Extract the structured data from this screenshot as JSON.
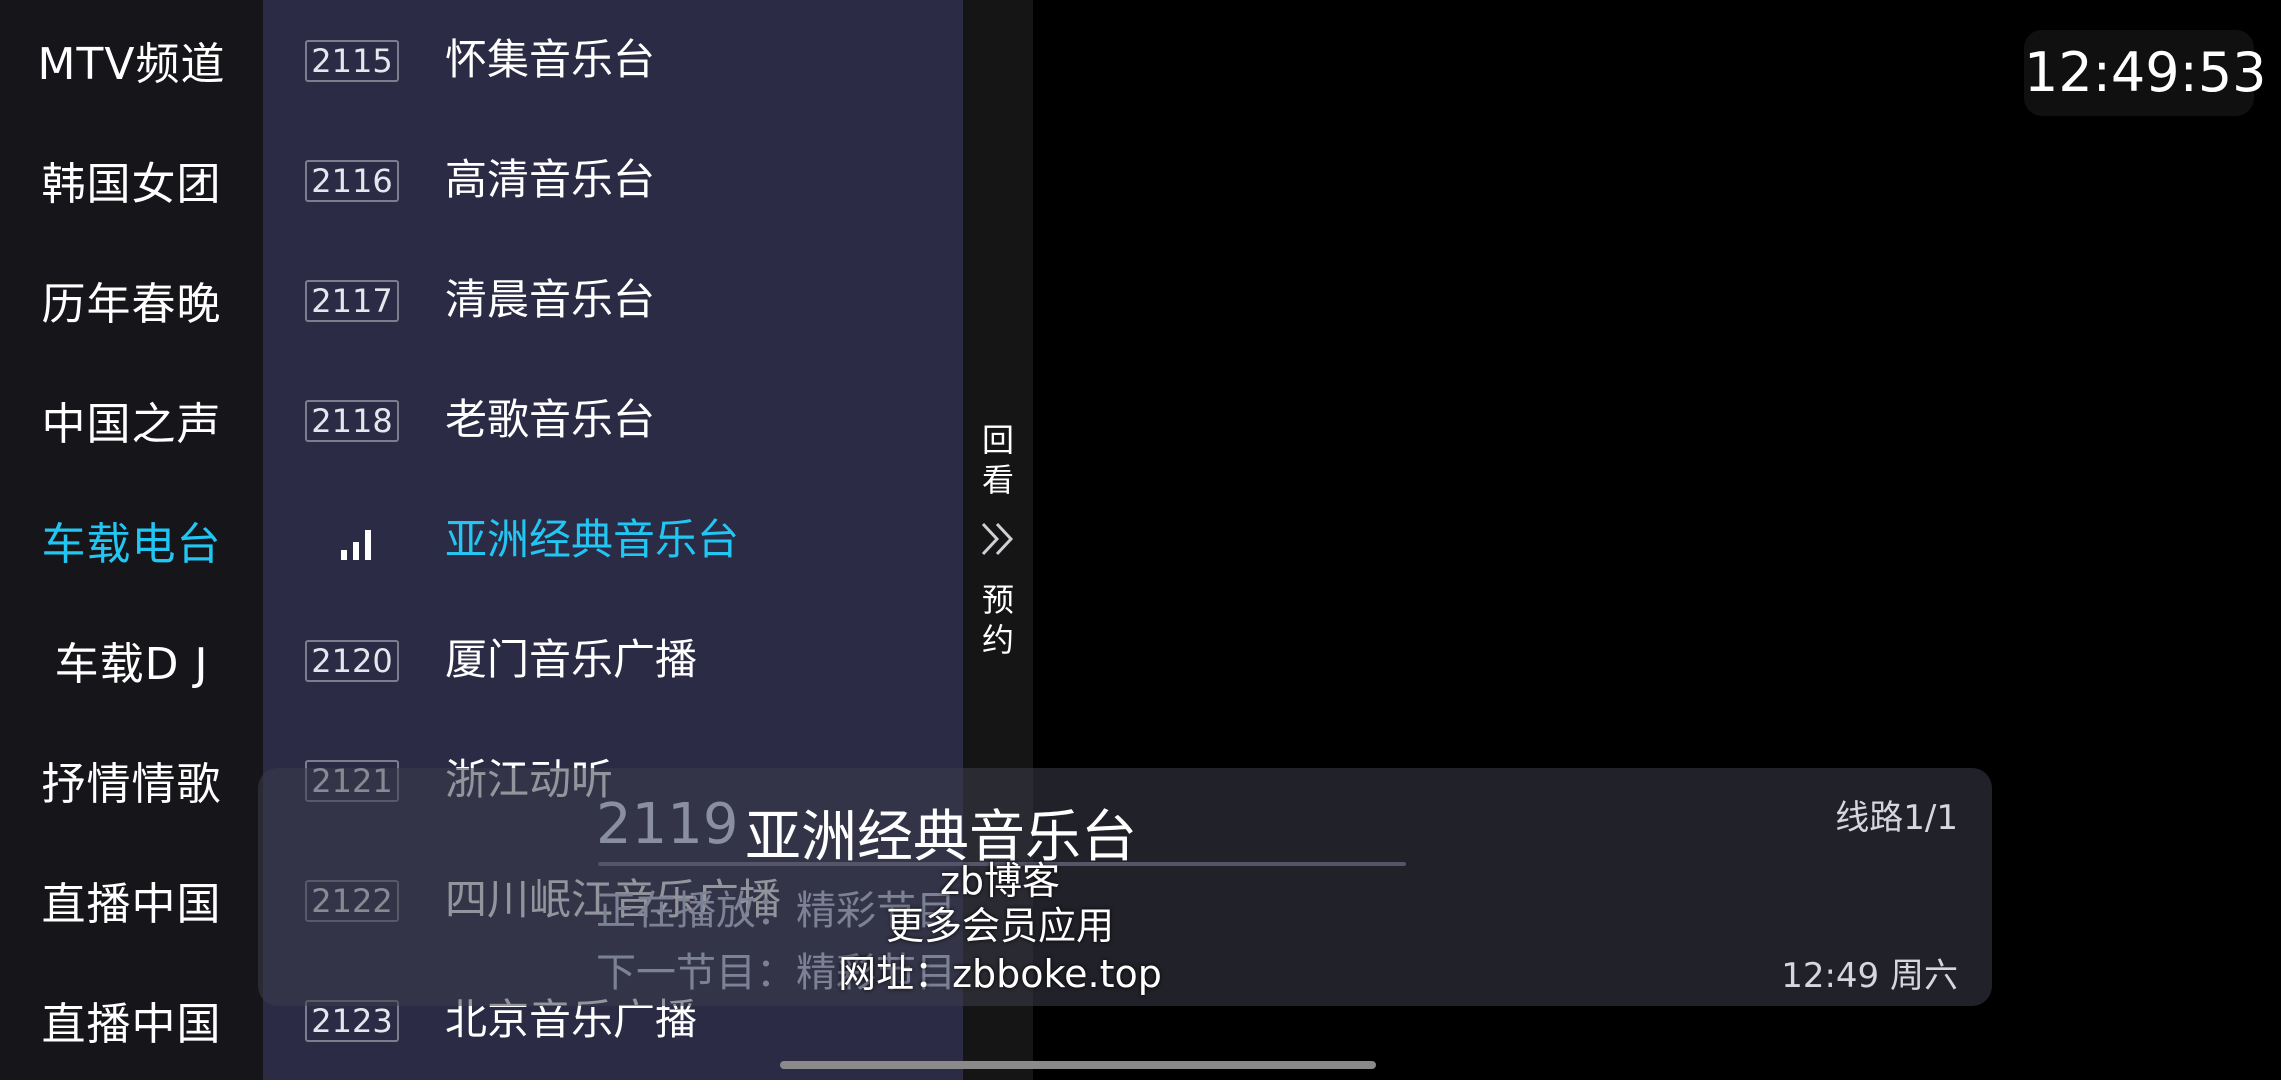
{
  "categories": [
    {
      "label": "MTV频道",
      "active": false
    },
    {
      "label": "韩国女团",
      "active": false
    },
    {
      "label": "历年春晚",
      "active": false
    },
    {
      "label": "中国之声",
      "active": false
    },
    {
      "label": "车载电台",
      "active": true
    },
    {
      "label": "车载D  J",
      "active": false
    },
    {
      "label": "抒情情歌",
      "active": false
    },
    {
      "label": "直播中国",
      "active": false
    },
    {
      "label": "直播中国",
      "active": false
    }
  ],
  "channels": [
    {
      "number": "2115",
      "name": "怀集音乐台",
      "active": false
    },
    {
      "number": "2116",
      "name": "高清音乐台",
      "active": false
    },
    {
      "number": "2117",
      "name": "清晨音乐台",
      "active": false
    },
    {
      "number": "2118",
      "name": "老歌音乐台",
      "active": false
    },
    {
      "number": "",
      "name": "亚洲经典音乐台",
      "active": true
    },
    {
      "number": "2120",
      "name": "厦门音乐广播",
      "active": false
    },
    {
      "number": "2121",
      "name": "浙江动听",
      "active": false
    },
    {
      "number": "2122",
      "name": "四川岷江音乐广播",
      "active": false
    },
    {
      "number": "2123",
      "name": "北京音乐广播",
      "active": false
    }
  ],
  "sidetab": {
    "replay": [
      "回",
      "看"
    ],
    "reserve": [
      "预",
      "约"
    ],
    "icon": "double-chevron-right-icon"
  },
  "clock": "12:49:53",
  "info": {
    "channel_number": "2119",
    "channel_name": "亚洲经典音乐台",
    "route": "线路1/1",
    "now_playing": "正在播放：精彩节目",
    "next_program": "下一节目：精彩节目",
    "time": "12:49 周六",
    "progress": 0
  },
  "watermark": {
    "line1": "zb博客",
    "line2": "更多会员应用",
    "line3": "网址：zbboke.top"
  },
  "colors": {
    "accent": "#22c6f3",
    "panel": "#2b2b45",
    "category_bg": "#15151a"
  }
}
